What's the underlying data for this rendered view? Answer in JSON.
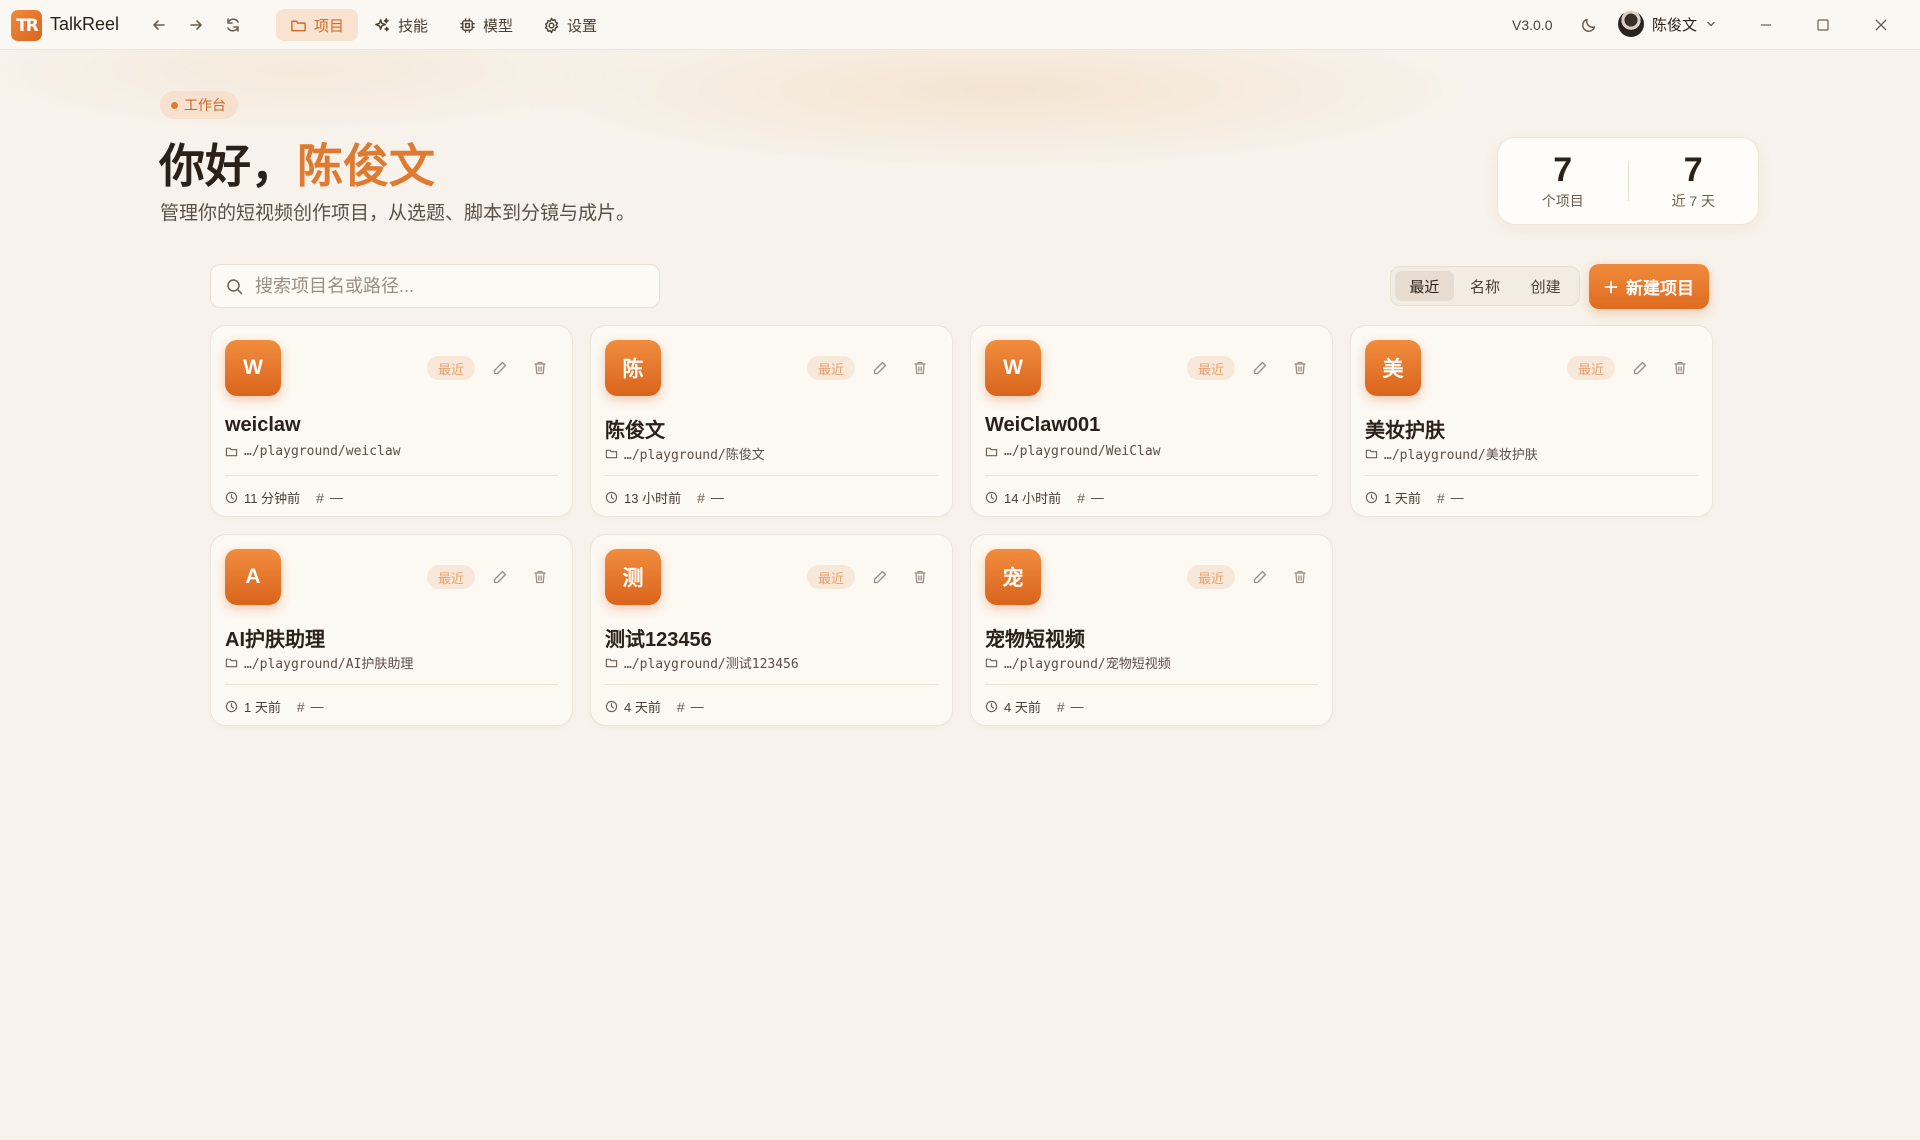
{
  "app": {
    "name": "TalkReel",
    "logo_text": "TR",
    "version": "V3.0.0"
  },
  "nav": [
    {
      "label": "项目",
      "icon": "folder-icon",
      "active": true
    },
    {
      "label": "技能",
      "icon": "sparkles-icon",
      "active": false
    },
    {
      "label": "模型",
      "icon": "cpu-icon",
      "active": false
    },
    {
      "label": "设置",
      "icon": "gear-icon",
      "active": false
    }
  ],
  "user": {
    "name": "陈俊文"
  },
  "header": {
    "tag": "工作台",
    "greeting_prefix": "你好，",
    "greeting_name": "陈俊文",
    "subtitle": "管理你的短视频创作项目，从选题、脚本到分镜与成片。"
  },
  "stats": [
    {
      "value": "7",
      "label": "个项目"
    },
    {
      "value": "7",
      "label": "近 7 天"
    }
  ],
  "search": {
    "placeholder": "搜索项目名或路径...",
    "value": ""
  },
  "sort": {
    "options": [
      "最近",
      "名称",
      "创建"
    ],
    "selected": "最近"
  },
  "new_project_label": "新建项目",
  "projects": [
    {
      "initial": "W",
      "badge": "最近",
      "title": "weiclaw",
      "path": "…/playground/weiclaw",
      "time": "11 分钟前",
      "tag": "—"
    },
    {
      "initial": "陈",
      "badge": "最近",
      "title": "陈俊文",
      "path": "…/playground/陈俊文",
      "time": "13 小时前",
      "tag": "—"
    },
    {
      "initial": "W",
      "badge": "最近",
      "title": "WeiClaw001",
      "path": "…/playground/WeiClaw",
      "time": "14 小时前",
      "tag": "—"
    },
    {
      "initial": "美",
      "badge": "最近",
      "title": "美妆护肤",
      "path": "…/playground/美妆护肤",
      "time": "1 天前",
      "tag": "—"
    },
    {
      "initial": "A",
      "badge": "最近",
      "title": "AI护肤助理",
      "path": "…/playground/AI护肤助理",
      "time": "1 天前",
      "tag": "—"
    },
    {
      "initial": "测",
      "badge": "最近",
      "title": "测试123456",
      "path": "…/playground/测试123456",
      "time": "4 天前",
      "tag": "—"
    },
    {
      "initial": "宠",
      "badge": "最近",
      "title": "宠物短视频",
      "path": "…/playground/宠物短视频",
      "time": "4 天前",
      "tag": "—"
    }
  ],
  "colors": {
    "accent": "#e07a30",
    "background": "#f7f3ec",
    "card": "#fcf8f2"
  }
}
